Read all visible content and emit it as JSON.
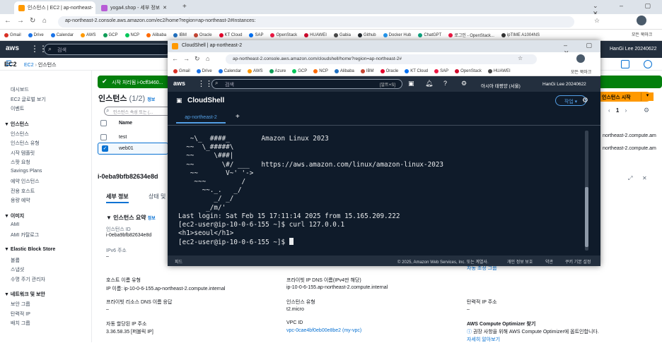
{
  "outer": {
    "tabs": [
      {
        "label": "인스턴스 | EC2 | ap-northeast-"
      },
      {
        "label": "yoga4.shop - 세부 정보"
      }
    ],
    "url": "ap-northeast-2.console.aws.amazon.com/ec2/home?region=ap-northeast-2#Instances:",
    "bookmarks": [
      "Gmail",
      "Drive",
      "Calendar",
      "AWS",
      "GCP",
      "NCP",
      "Alibaba",
      "IBM",
      "Oracle",
      "KT Cloud",
      "SAP",
      "OpenStack",
      "HUAWEI",
      "Gabia",
      "Github",
      "Docker Hub",
      "ChatGPT",
      "로그인 - OpenStack...",
      "ipTIME A1004NS"
    ],
    "bookmark_folder": "모든 북마크",
    "search_placeholder": "검색",
    "user": "HanGi Lee 20240622",
    "breadcrumb": [
      "EC2",
      "인스턴스"
    ],
    "section_title": "EC2",
    "launch_button": "인스턴스 시작",
    "alert": "시작 처리됨 i-0cff3460...",
    "instances_title": "인스턴스",
    "instances_count": "(1/2)",
    "info": "정보",
    "filter_placeholder": "인스턴스 속성 또는 (...",
    "name_col": "Name",
    "rows": [
      {
        "name": "test"
      },
      {
        "name": "web01"
      }
    ],
    "pager": "1",
    "dns_frag": [
      "northeast-2.compute.am",
      "northeast-2.compute.am"
    ],
    "instance_id_heading": "i-0eba9bfb82634e8d",
    "detail_tabs": [
      "세부 정보",
      "상태 및"
    ],
    "summary_title": "인스턴스 요약",
    "summary_info": "정보",
    "fields": {
      "instance_id_label": "인스턴스 ID",
      "instance_id_value": "i-0eba9bfb82634e8d",
      "ipv6_label": "IPv6 주소",
      "ipv6_value": "–",
      "hostname_type_label": "호스트 이름 유형",
      "hostname_type_value": "IP 이름: ip-10-0-6-155.ap-northeast-2.compute.internal",
      "private_dns_req_label": "프라이빗 리소스 DNS 이름 응답",
      "private_dns_req_value": "–",
      "auto_ip_label": "자동 할당된 IP 주소",
      "auto_ip_value": "3.36.58.35 [퍼블릭 IP]",
      "private_dns_label": "프라이빗 IP DNS 이름(IPv4만 해당)",
      "private_dns_value": "ip-10-0-6-155.ap-northeast-2.compute.internal",
      "instance_type_label": "인스턴스 유형",
      "instance_type_value": "t2.micro",
      "vpc_label": "VPC ID",
      "vpc_value": "vpc-0cae4bf0eb00e8be2 (my-vpc)",
      "elastic_ip_label": "탄력적 IP 주소",
      "elastic_ip_value": "–",
      "optimizer_label": "AWS Compute Optimizer 찾기",
      "optimizer_value": "권장 사항을 위해 AWS Compute Optimizer에 옵트인합니다.",
      "optimizer_link": "자세히 알아보기",
      "right_frag": "자동 조정 그룹"
    },
    "sidebar": [
      {
        "t": "대시보드",
        "h": false
      },
      {
        "t": "EC2 글로벌 보기",
        "h": false
      },
      {
        "t": "이벤트",
        "h": false
      },
      {
        "t": "인스턴스",
        "h": true
      },
      {
        "t": "인스턴스",
        "h": false
      },
      {
        "t": "인스턴스 유형",
        "h": false
      },
      {
        "t": "시작 템플릿",
        "h": false
      },
      {
        "t": "스팟 요청",
        "h": false
      },
      {
        "t": "Savings Plans",
        "h": false
      },
      {
        "t": "예약 인스턴스",
        "h": false
      },
      {
        "t": "전용 호스트",
        "h": false
      },
      {
        "t": "용량 예약",
        "h": false
      },
      {
        "t": "이미지",
        "h": true
      },
      {
        "t": "AMI",
        "h": false
      },
      {
        "t": "AMI 카탈로그",
        "h": false
      },
      {
        "t": "Elastic Block Store",
        "h": true
      },
      {
        "t": "볼륨",
        "h": false
      },
      {
        "t": "스냅샷",
        "h": false
      },
      {
        "t": "수명 주기 관리자",
        "h": false
      },
      {
        "t": "네트워크 및 보안",
        "h": true
      },
      {
        "t": "보안 그룹",
        "h": false
      },
      {
        "t": "탄력적 IP",
        "h": false
      },
      {
        "t": "배치 그룹",
        "h": false
      }
    ]
  },
  "cloudshell": {
    "tab_title": "CloudShell | ap-northeast-2",
    "url": "ap-northeast-2.console.aws.amazon.com/cloudshell/home?region=ap-northeast-2#",
    "bookmarks": [
      "Gmail",
      "Drive",
      "Calendar",
      "AWS",
      "Azure",
      "GCP",
      "NCP",
      "Alibaba",
      "IBM",
      "Oracle",
      "KT Cloud",
      "SAP",
      "OpenStack",
      "HUAWEI"
    ],
    "bookmark_folder": "모든 북마크",
    "search_placeholder": "검색",
    "search_shortcut": "[알트+S]",
    "region": "아시아 태평양 (서울)",
    "user": "HanGi Lee 20240622",
    "title": "CloudShell",
    "actions": "작업",
    "session_tab": "ap-northeast-2",
    "terminal_lines": [
      "   ~\\_  ####_        Amazon Linux 2023",
      "  ~~  \\_#####\\",
      "  ~~     \\###|",
      "  ~~       \\#/ ___   https://aws.amazon.com/linux/amazon-linux-2023",
      "   ~~       V~' '->",
      "    ~~~         /",
      "      ~~._.   _/",
      "         _/ _/",
      "       _/m/'",
      "Last login: Sat Feb 15 17:11:14 2025 from 15.165.209.222",
      "[ec2-user@ip-10-0-6-155 ~]$ curl 127.0.0.1",
      "<h1>seoul</h1>",
      "[ec2-user@ip-10-0-6-155 ~]$ "
    ],
    "footer_left": "피드",
    "footer_copyright": "© 2025, Amazon Web Services, Inc. 또는 계열사.",
    "footer_privacy": "개인 정보 보호",
    "footer_terms": "약관",
    "footer_cookie": "쿠키 기본 설정"
  }
}
